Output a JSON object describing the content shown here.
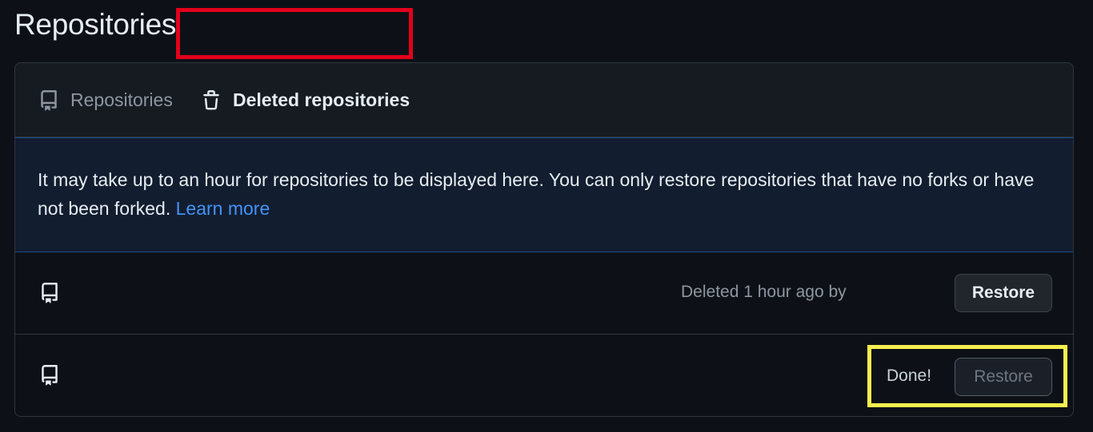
{
  "page": {
    "title": "Repositories"
  },
  "tabs": [
    {
      "label": "Repositories",
      "icon": "repo-icon",
      "active": false
    },
    {
      "label": "Deleted repositories",
      "icon": "trash-icon",
      "active": true
    }
  ],
  "notice": {
    "text": "It may take up to an hour for repositories to be displayed here. You can only restore repositories that have no forks or have not been forked.",
    "link_label": "Learn more"
  },
  "deleted_repositories": [
    {
      "icon": "repo-icon",
      "status": "Deleted 1 hour ago by",
      "action_label": "Restore",
      "action_enabled": true
    },
    {
      "icon": "repo-icon",
      "status": "Done!",
      "action_label": "Restore",
      "action_enabled": false
    }
  ],
  "annotations": {
    "red_highlight_color": "#e3001b",
    "yellow_highlight_color": "#f7f04f"
  },
  "colors": {
    "background": "#0d1117",
    "link": "#4493f8",
    "border": "#30363d"
  }
}
